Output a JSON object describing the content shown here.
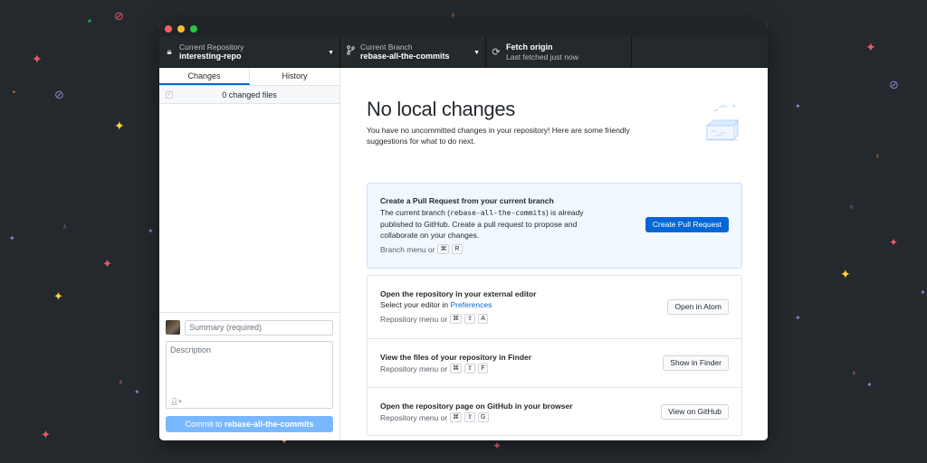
{
  "toolbar": {
    "repository": {
      "label": "Current Repository",
      "value": "interesting-repo",
      "icon": "lock-icon"
    },
    "branch": {
      "label": "Current Branch",
      "value": "rebase-all-the-commits",
      "icon": "branch-icon"
    },
    "fetch": {
      "label": "Fetch origin",
      "sub": "Last fetched just now",
      "icon": "sync-icon"
    }
  },
  "sidebar": {
    "tabs": [
      "Changes",
      "History"
    ],
    "changed_files": "0 changed files",
    "summary_placeholder": "Summary (required)",
    "description_placeholder": "Description",
    "commit_prefix": "Commit to",
    "commit_branch": "rebase-all-the-commits"
  },
  "main": {
    "heading": "No local changes",
    "subtext": "You have no uncommitted changes in your repository! Here are some friendly suggestions for what to do next.",
    "pr": {
      "title": "Create a Pull Request from your current branch",
      "body_1": "The current branch (",
      "body_branch": "rebase-all-the-commits",
      "body_2": ") is already published to GitHub. Create a pull request to propose and collaborate on your changes.",
      "hint": "Branch menu or",
      "keys": [
        "⌘",
        "R"
      ],
      "button": "Create Pull Request"
    },
    "editor": {
      "title": "Open the repository in your external editor",
      "body": "Select your editor in",
      "link": "Preferences",
      "hint": "Repository menu or",
      "keys": [
        "⌘",
        "⇧",
        "A"
      ],
      "button": "Open in Atom"
    },
    "finder": {
      "title": "View the files of your repository in Finder",
      "hint": "Repository menu or",
      "keys": [
        "⌘",
        "⇧",
        "F"
      ],
      "button": "Show in Finder"
    },
    "github": {
      "title": "Open the repository page on GitHub in your browser",
      "hint": "Repository menu or",
      "keys": [
        "⌘",
        "⇧",
        "G"
      ],
      "button": "View on GitHub"
    }
  },
  "colors": {
    "background": "#24292e",
    "accent": "#0366d6",
    "commit_button": "#79b8ff",
    "pr_card": "#f1f8ff"
  }
}
